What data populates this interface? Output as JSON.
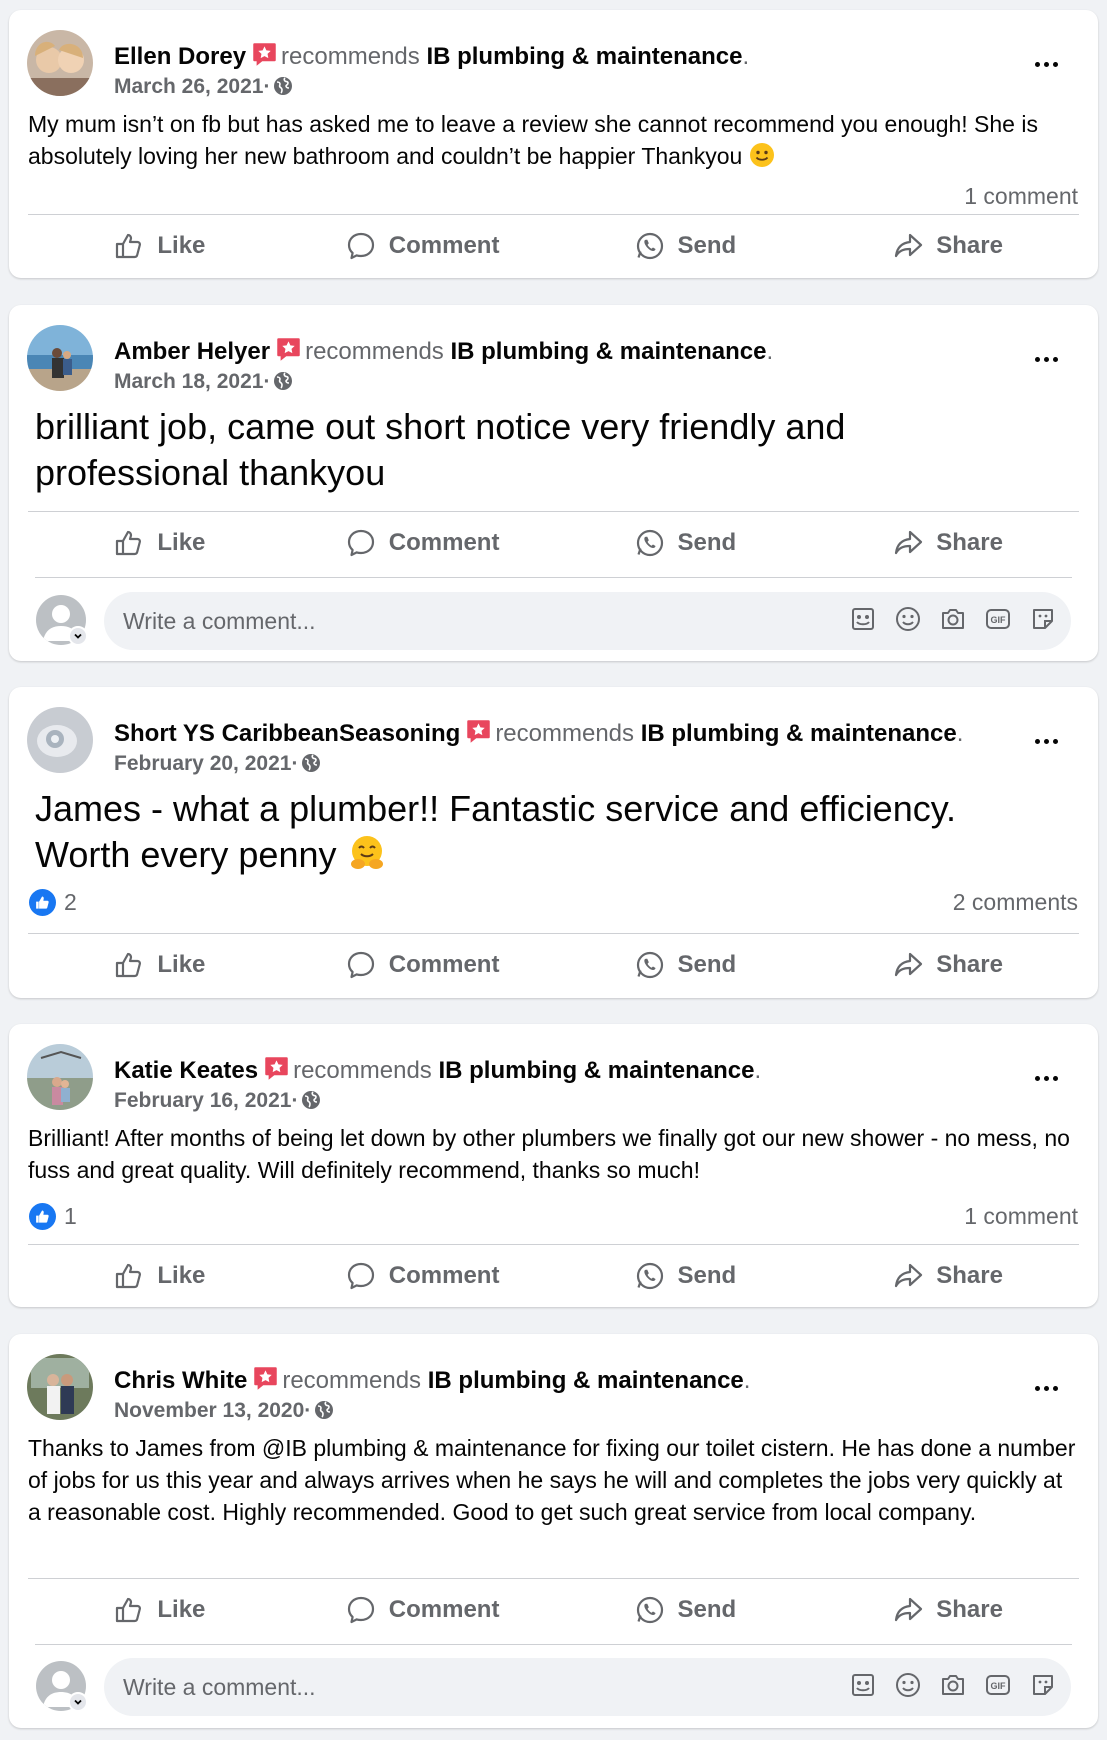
{
  "colors": {
    "background": "#f0f2f5",
    "accent": "#1877f2",
    "muted": "#65676b",
    "badge": "#e8465d"
  },
  "actions": {
    "like": "Like",
    "comment": "Comment",
    "send": "Send",
    "share": "Share"
  },
  "comment_placeholder": "Write a comment...",
  "posts": [
    {
      "author": "Ellen Dorey",
      "verb": "recommends",
      "page": "IB plumbing & maintenance",
      "date": "March 26, 2021",
      "text": "My mum isn’t on fb but has asked me to leave a review she cannot recommend you enough! She is absolutely loving her new bathroom and couldn’t be happier Thankyou",
      "emoji": "slightly-smiling-face",
      "likes": "",
      "comments": "1 comment"
    },
    {
      "author": "Amber Helyer",
      "verb": "recommends",
      "page": "IB plumbing & maintenance",
      "date": "March 18, 2021",
      "text": "brilliant job, came out short notice very friendly and professional thankyou",
      "likes": "",
      "comments": ""
    },
    {
      "author": "Short YS CaribbeanSeasoning",
      "verb": "recommends",
      "page": "IB plumbing & maintenance",
      "date": "February 20, 2021",
      "text": "James - what a plumber!! Fantastic service and efficiency. Worth every penny",
      "emoji": "hugging-face",
      "likes": "2",
      "comments": "2 comments"
    },
    {
      "author": "Katie Keates",
      "verb": "recommends",
      "page": "IB plumbing & maintenance",
      "date": "February 16, 2021",
      "text": "Brilliant! After months of being let down by other plumbers we finally got our new shower - no mess, no fuss and great quality. Will definitely recommend, thanks so much!",
      "likes": "1",
      "comments": "1 comment"
    },
    {
      "author": "Chris White",
      "verb": "recommends",
      "page": "IB plumbing & maintenance",
      "date": "November 13, 2020",
      "text": "Thanks to James from @IB plumbing & maintenance for fixing our toilet cistern. He has done a number of jobs for us this year and always arrives when he says he will and completes the jobs very quickly at a reasonable cost. Highly recommended. Good to get such great service from local company.",
      "likes": "",
      "comments": ""
    }
  ]
}
